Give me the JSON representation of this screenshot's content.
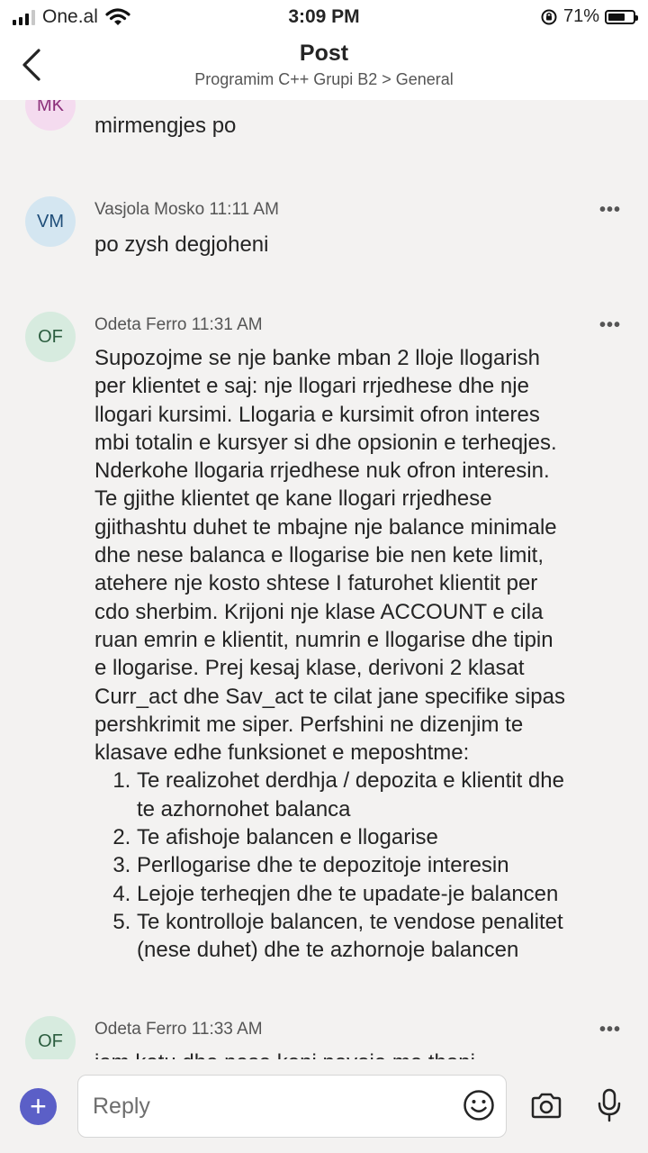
{
  "status_bar": {
    "carrier": "One.al",
    "time": "3:09 PM",
    "battery_percent": "71%",
    "battery_level": 0.71
  },
  "header": {
    "title": "Post",
    "subtitle": "Programim C++ Grupi B2 > General"
  },
  "messages": [
    {
      "initials": "MK",
      "author": "",
      "time": "",
      "text": "mirmengjes po"
    },
    {
      "initials": "VM",
      "author": "Vasjola Mosko",
      "time": "11:11 AM",
      "text": "po zysh degjoheni"
    },
    {
      "initials": "OF",
      "author": "Odeta Ferro",
      "time": "11:31 AM",
      "paragraph": [
        "Supozojme se nje banke mban 2 lloje llogarish",
        "per klientet e saj: nje llogari rrjedhese dhe nje",
        "llogari kursimi. Llogaria e kursimit ofron interes",
        "mbi totalin e kursyer si dhe opsionin e terheqjes.",
        "Nderkohe llogaria rrjedhese nuk ofron interesin.",
        "Te gjithe klientet qe kane llogari rrjedhese",
        "gjithashtu duhet te mbajne nje balance minimale",
        "dhe nese balanca e llogarise bie nen kete limit,",
        "atehere nje kosto shtese I faturohet klientit per",
        "cdo sherbim. Krijoni nje klase ACCOUNT e cila",
        "ruan emrin e klientit, numrin e llogarise dhe tipin",
        "e llogarise. Prej kesaj klase, derivoni 2 klasat",
        "Curr_act dhe Sav_act te cilat jane specifike sipas",
        "pershkrimit me siper. Perfshini ne dizenjim te",
        "klasave edhe funksionet e meposhtme:"
      ],
      "list": [
        [
          "Te realizohet derdhja / depozita e klientit dhe",
          "te azhornohet balanca"
        ],
        [
          "Te afishoje balancen e llogarise"
        ],
        [
          "Perllogarise dhe te depozitoje interesin"
        ],
        [
          "Lejoje terheqjen dhe te upadate-je balancen"
        ],
        [
          "Te kontrolloje balancen, te vendose penalitet",
          "(nese duhet) dhe te azhornoje balancen"
        ]
      ]
    },
    {
      "initials": "OF",
      "author": "Odeta Ferro",
      "time": "11:33 AM",
      "text": "jam ketu dhe nese keni nevoje me thoni"
    }
  ],
  "more_label": "•••",
  "composer": {
    "placeholder": "Reply",
    "add_label": "+"
  },
  "icons": {
    "back": "chevron-left-icon",
    "add": "plus-icon",
    "emoji": "smiley-icon",
    "camera": "camera-icon",
    "mic": "microphone-icon"
  },
  "colors": {
    "accent": "#5b5fc7",
    "mk_avatar_bg": "#f4dbef",
    "mk_avatar_fg": "#8b2f7a",
    "vm_avatar_bg": "#d4e6f1",
    "vm_avatar_fg": "#1f4e79",
    "of_avatar_bg": "#d7ebdf",
    "of_avatar_fg": "#2b5d3f"
  }
}
